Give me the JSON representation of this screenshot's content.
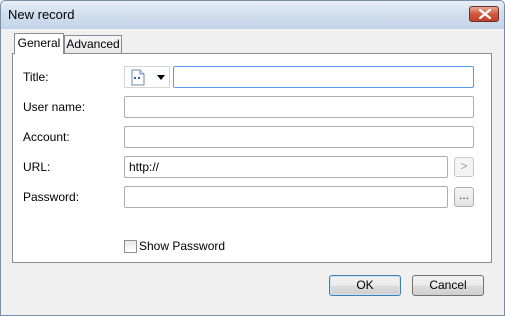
{
  "window": {
    "title": "New record"
  },
  "tabs": [
    {
      "label": "General",
      "selected": true
    },
    {
      "label": "Advanced",
      "selected": false
    }
  ],
  "form": {
    "title": {
      "label": "Title:",
      "value": "",
      "icon": "document-icon"
    },
    "username": {
      "label": "User name:",
      "value": ""
    },
    "account": {
      "label": "Account:",
      "value": ""
    },
    "url": {
      "label": "URL:",
      "value": "http://",
      "open_button": ">"
    },
    "password": {
      "label": "Password:",
      "value": "",
      "generate_button": "..."
    },
    "show_password": {
      "label": "Show Password",
      "checked": false
    }
  },
  "buttons": {
    "ok": "OK",
    "cancel": "Cancel"
  },
  "colors": {
    "accent_border": "#569de5",
    "default_button_border": "#3c7fb1"
  }
}
